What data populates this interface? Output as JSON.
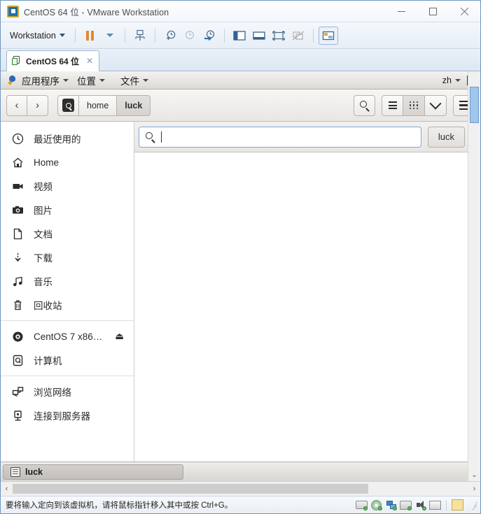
{
  "window": {
    "title": "CentOS 64 位 - VMware Workstation",
    "icon": "vmware-icon",
    "minimize_label": "最小化",
    "maximize_label": "最大化",
    "close_label": "关闭"
  },
  "vm_toolbar": {
    "menu_label": "Workstation",
    "buttons": [
      {
        "name": "pause-vm-button",
        "icon": "pause-icon"
      },
      {
        "name": "power-dropdown-button",
        "icon": "caret-down-icon"
      },
      {
        "name": "manage-snapshots-button",
        "icon": "snapshot-icon"
      },
      {
        "name": "take-snapshot-button",
        "icon": "snapshot-add-icon"
      },
      {
        "name": "revert-snapshot-button",
        "icon": "snapshot-revert-icon"
      },
      {
        "name": "snapshot-manager-button",
        "icon": "snapshot-manager-icon"
      },
      {
        "name": "show-library-button",
        "icon": "library-panel-icon"
      },
      {
        "name": "show-thumbnails-button",
        "icon": "thumbnail-bar-icon"
      },
      {
        "name": "fullscreen-button",
        "icon": "fullscreen-icon"
      },
      {
        "name": "unity-mode-button",
        "icon": "unity-icon"
      },
      {
        "name": "console-view-button",
        "icon": "console-view-icon"
      }
    ]
  },
  "vm_tab": {
    "label": "CentOS 64 位",
    "close_label": "✕"
  },
  "gnome_panel": {
    "applications": "应用程序",
    "places": "位置",
    "files": "文件",
    "keyboard_layout": "zh",
    "calendar_icon": "calendar-icon"
  },
  "nautilus": {
    "back_label": "‹",
    "forward_label": "›",
    "breadcrumbs": [
      {
        "label": "",
        "icon": "computer-drive-icon",
        "current": false
      },
      {
        "label": "home",
        "current": false
      },
      {
        "label": "luck",
        "current": true
      }
    ],
    "header_buttons": [
      {
        "name": "search-toggle-button",
        "icon": "search-icon"
      },
      {
        "name": "list-view-button",
        "icon": "list-view-icon"
      },
      {
        "name": "grid-view-button",
        "icon": "grid-view-icon"
      },
      {
        "name": "view-options-button",
        "icon": "chevron-down-icon"
      },
      {
        "name": "main-menu-button",
        "icon": "hamburger-icon"
      }
    ],
    "search": {
      "value": "",
      "placeholder": "",
      "icon": "search-icon"
    },
    "location_button": "luck",
    "sidebar": [
      {
        "label": "最近使用的",
        "icon": "clock-icon",
        "group": 0
      },
      {
        "label": "Home",
        "icon": "home-icon",
        "group": 0
      },
      {
        "label": "视频",
        "icon": "video-icon",
        "group": 0
      },
      {
        "label": "图片",
        "icon": "camera-icon",
        "group": 0
      },
      {
        "label": "文档",
        "icon": "document-icon",
        "group": 0
      },
      {
        "label": "下载",
        "icon": "download-icon",
        "group": 0
      },
      {
        "label": "音乐",
        "icon": "music-icon",
        "group": 0
      },
      {
        "label": "回收站",
        "icon": "trash-icon",
        "group": 0
      },
      {
        "label": "CentOS 7 x86…",
        "icon": "disc-icon",
        "group": 1,
        "eject": "⏏"
      },
      {
        "label": "计算机",
        "icon": "computer-drive-icon",
        "group": 1
      },
      {
        "label": "浏览网络",
        "icon": "network-icon",
        "group": 2
      },
      {
        "label": "连接到服务器",
        "icon": "server-icon",
        "group": 2
      }
    ]
  },
  "gnome_taskbar": {
    "windows": [
      {
        "label": "luck",
        "icon": "file-manager-icon"
      }
    ]
  },
  "status_bar": {
    "message": "要将输入定向到该虚拟机，请将鼠标指针移入其中或按 Ctrl+G。",
    "devices": [
      {
        "name": "hard-disk-device-icon"
      },
      {
        "name": "cd-dvd-device-icon"
      },
      {
        "name": "network-adapter-device-icon"
      },
      {
        "name": "printer-device-icon"
      },
      {
        "name": "sound-card-device-icon"
      },
      {
        "name": "display-device-icon"
      },
      {
        "name": "notes-icon"
      }
    ]
  },
  "colors": {
    "accent": "#3b86d0",
    "vm_chrome": "#eef3f9",
    "selection": "#9fc6ec",
    "pause_orange": "#e08a2e"
  }
}
